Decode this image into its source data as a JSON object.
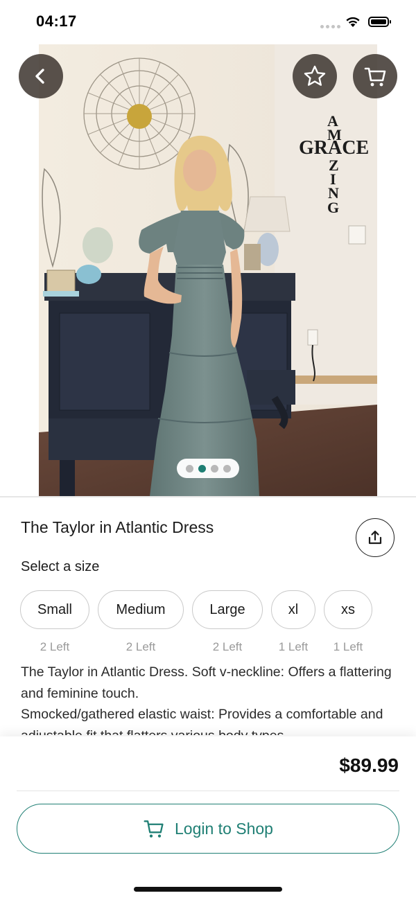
{
  "status_bar": {
    "time": "04:17",
    "icons": [
      "signal-dots-icon",
      "wifi-icon",
      "battery-icon"
    ]
  },
  "hero": {
    "wall_text": "GRACE",
    "wall_text_vertical": [
      "A",
      "M",
      "Z",
      "I",
      "N",
      "G"
    ],
    "buttons": [
      "chevron-left-icon",
      "star-icon",
      "cart-icon"
    ],
    "pager": {
      "count": 4,
      "active_index": 1,
      "active_color": "#1f7f74"
    }
  },
  "product": {
    "title": "The Taylor in Atlantic Dress",
    "select_size_label": "Select a size",
    "sizes": [
      {
        "label": "Small",
        "stock": "2 Left"
      },
      {
        "label": "Medium",
        "stock": "2 Left"
      },
      {
        "label": "Large",
        "stock": "2 Left"
      },
      {
        "label": "xl",
        "stock": "1 Left"
      },
      {
        "label": "xs",
        "stock": "1 Left"
      }
    ],
    "description": "The Taylor in Atlantic Dress. Soft v-neckline: Offers a flattering and feminine touch.\nSmocked/gathered elastic waist: Provides a comfortable and adjustable fit that flatters various body types."
  },
  "purchase": {
    "price": "$89.99",
    "login_button_label": "Login to Shop"
  },
  "colors": {
    "accent": "#1f7f74",
    "button_overlay": "#423a34"
  }
}
